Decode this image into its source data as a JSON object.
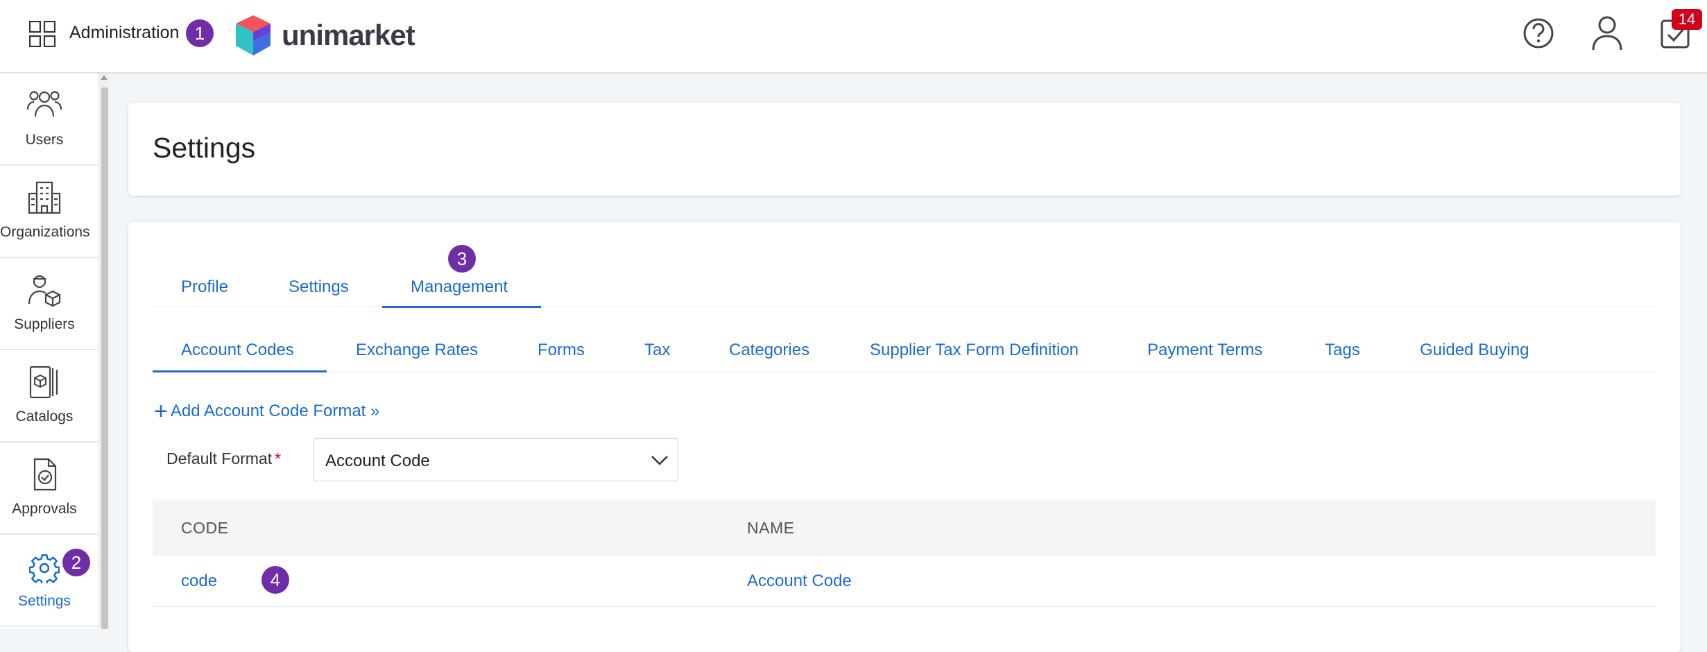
{
  "header": {
    "app_title": "Administration",
    "logo_text": "unimarket",
    "notification_count": "14",
    "step_badge": "1"
  },
  "sidebar": {
    "items": [
      {
        "label": "Users",
        "icon": "users-icon"
      },
      {
        "label": "Organizations",
        "icon": "building-icon"
      },
      {
        "label": "Suppliers",
        "icon": "supplier-icon"
      },
      {
        "label": "Catalogs",
        "icon": "catalog-icon"
      },
      {
        "label": "Approvals",
        "icon": "approval-icon"
      },
      {
        "label": "Settings",
        "icon": "gear-icon",
        "badge": "2"
      }
    ]
  },
  "page": {
    "title": "Settings"
  },
  "tabs": {
    "primary": [
      "Profile",
      "Settings",
      "Management"
    ],
    "primary_badge": "3",
    "secondary": [
      "Account Codes",
      "Exchange Rates",
      "Forms",
      "Tax",
      "Categories",
      "Supplier Tax Form Definition",
      "Payment Terms",
      "Tags",
      "Guided Buying"
    ]
  },
  "account_codes": {
    "add_link": "Add Account Code Format »",
    "default_format_label": "Default Format",
    "required_mark": "*",
    "default_format_value": "Account Code",
    "columns": [
      "CODE",
      "NAME"
    ],
    "rows": [
      {
        "code": "code",
        "name": "Account Code",
        "badge": "4"
      }
    ]
  },
  "colors": {
    "accent": "#1a6bd1",
    "badge": "#6f2da8",
    "alert": "#d0021b"
  }
}
